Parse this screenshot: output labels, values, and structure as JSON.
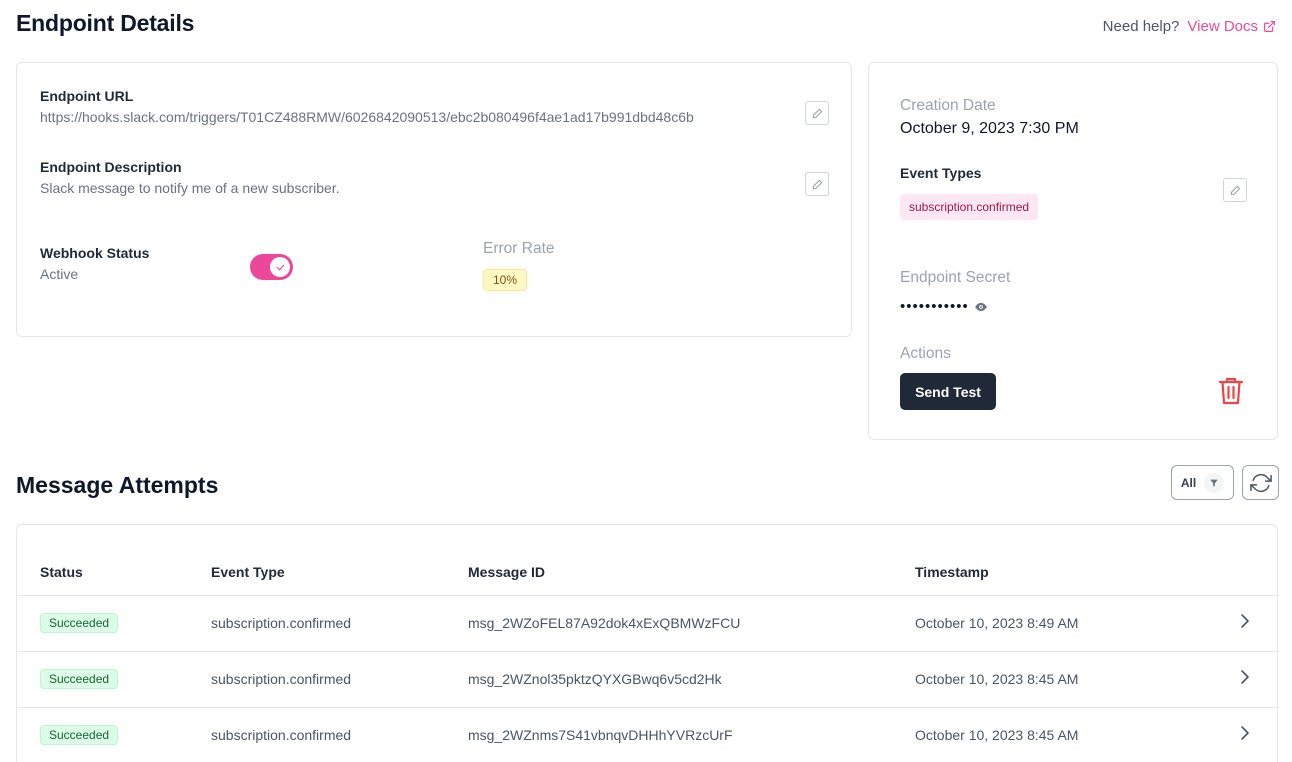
{
  "page": {
    "title": "Endpoint Details",
    "help_text": "Need help?",
    "docs_link": "View Docs"
  },
  "details": {
    "url_label": "Endpoint URL",
    "url_value": "https://hooks.slack.com/triggers/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",
    "description_label": "Endpoint Description",
    "description_value": "Slack message to notify me of a new subscriber.",
    "status_label": "Webhook Status",
    "status_value": "Active",
    "status_enabled": true,
    "error_rate_label": "Error Rate",
    "error_rate_value": "10%"
  },
  "meta": {
    "creation_label": "Creation Date",
    "creation_value": "October 9, 2023 7:30 PM",
    "event_types_label": "Event Types",
    "event_types": [
      "subscription.confirmed"
    ],
    "secret_label": "Endpoint Secret",
    "secret_mask": "•••••••••••",
    "actions_label": "Actions",
    "send_test_label": "Send Test"
  },
  "attempts": {
    "title": "Message Attempts",
    "filter_label": "All",
    "columns": [
      "Status",
      "Event Type",
      "Message ID",
      "Timestamp"
    ],
    "rows": [
      {
        "status": "Succeeded",
        "event_type": "subscription.confirmed",
        "message_id": "msg_2WZoFEL87A92dok4xExQBMWzFCU",
        "timestamp": "October 10, 2023 8:49 AM"
      },
      {
        "status": "Succeeded",
        "event_type": "subscription.confirmed",
        "message_id": "msg_2WZnol35pktzQYXGBwq6v5cd2Hk",
        "timestamp": "October 10, 2023 8:45 AM"
      },
      {
        "status": "Succeeded",
        "event_type": "subscription.confirmed",
        "message_id": "msg_2WZnms7S41vbnqvDHHhYVRzcUrF",
        "timestamp": "October 10, 2023 8:45 AM"
      }
    ]
  },
  "colors": {
    "accent": "#ec4899",
    "danger": "#ef4444",
    "primary_button": "#1f2937",
    "success_bg": "#dcfce7"
  },
  "icons": {
    "external_link": "external-link-icon",
    "edit": "pencil-icon",
    "eye": "eye-icon",
    "trash": "trash-icon",
    "filter": "filter-icon",
    "refresh": "refresh-icon",
    "chevron": "chevron-right-icon",
    "check": "check-icon"
  }
}
